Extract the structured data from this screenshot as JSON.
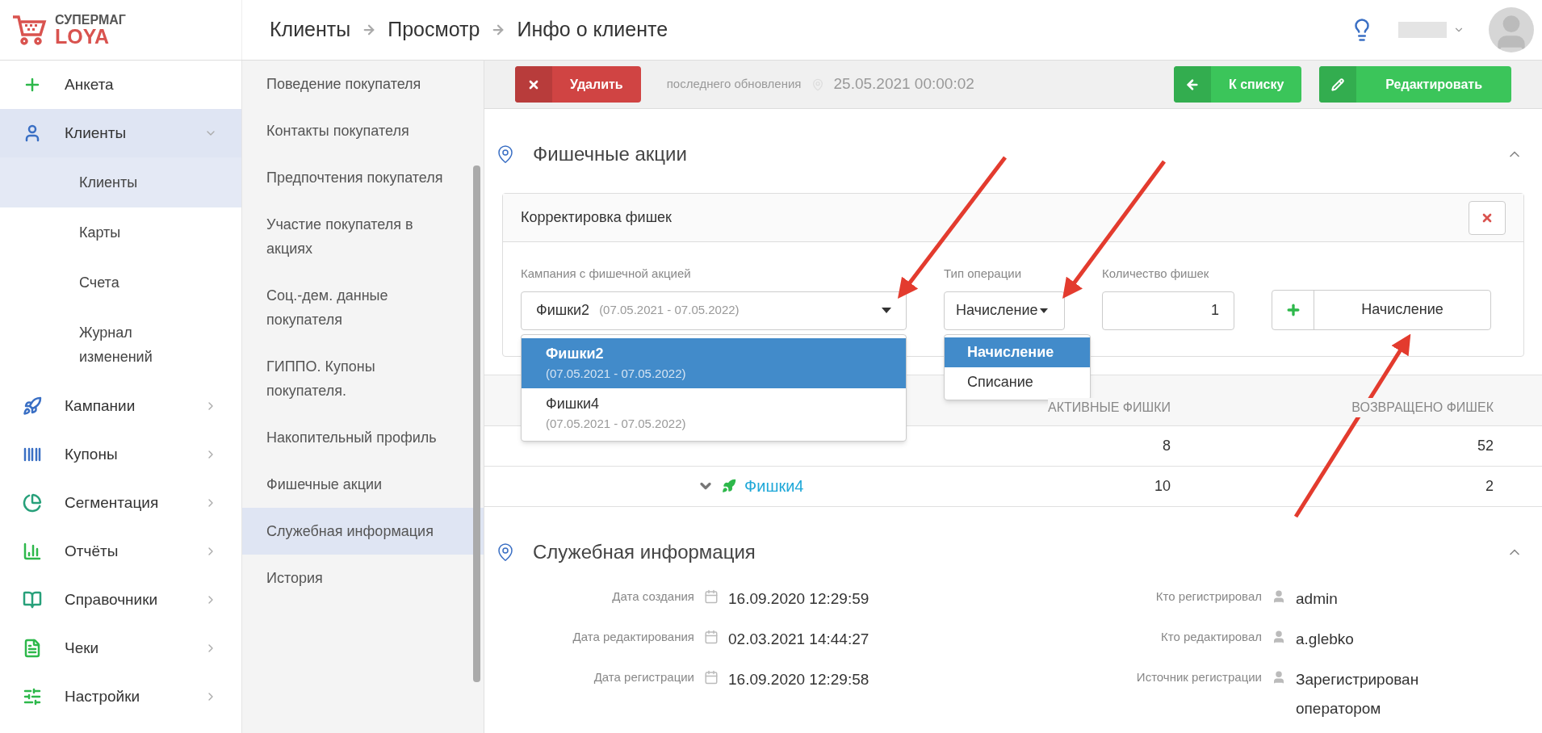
{
  "logo": {
    "top": "СУПЕРМАГ",
    "bottom": "LOYA"
  },
  "breadcrumbs": [
    "Клиенты",
    "Просмотр",
    "Инфо о клиенте"
  ],
  "sidebar": {
    "items": [
      {
        "label": "Анкета",
        "selected": false,
        "expandable": false
      },
      {
        "label": "Клиенты",
        "selected": true,
        "expandable": true,
        "expanded": true,
        "children": [
          {
            "label": "Клиенты",
            "selected": true
          },
          {
            "label": "Карты",
            "selected": false
          },
          {
            "label": "Счета",
            "selected": false
          },
          {
            "label": "Журнал изменений",
            "selected": false
          }
        ]
      },
      {
        "label": "Кампании",
        "selected": false,
        "expandable": true,
        "expanded": false
      },
      {
        "label": "Купоны",
        "selected": false,
        "expandable": true,
        "expanded": false
      },
      {
        "label": "Сегментация",
        "selected": false,
        "expandable": true,
        "expanded": false
      },
      {
        "label": "Отчёты",
        "selected": false,
        "expandable": true,
        "expanded": false
      },
      {
        "label": "Справочники",
        "selected": false,
        "expandable": true,
        "expanded": false
      },
      {
        "label": "Чеки",
        "selected": false,
        "expandable": true,
        "expanded": false
      },
      {
        "label": "Настройки",
        "selected": false,
        "expandable": true,
        "expanded": false
      }
    ]
  },
  "subnav": {
    "items": [
      {
        "label": "Поведение покупателя",
        "selected": false
      },
      {
        "label": "Контакты покупателя",
        "selected": false
      },
      {
        "label": "Предпочтения покупателя",
        "selected": false
      },
      {
        "label": "Участие покупателя в акциях",
        "selected": false
      },
      {
        "label": "Соц.-дем. данные покупателя",
        "selected": false
      },
      {
        "label": "ГИППО. Купоны покупателя.",
        "selected": false
      },
      {
        "label": "Накопительный профиль",
        "selected": false
      },
      {
        "label": "Фишечные акции",
        "selected": false
      },
      {
        "label": "Служебная информация",
        "selected": true
      },
      {
        "label": "История",
        "selected": false
      }
    ]
  },
  "toolbar": {
    "delete_button": "Удалить",
    "update_label": "последнего обновления",
    "update_value": "25.05.2021 00:00:02",
    "back_button": "К списку",
    "edit_button": "Редактировать"
  },
  "chips_section": {
    "title": "Фишечные акции",
    "expanded": true,
    "card": {
      "title": "Корректировка фишек",
      "campaign_label": "Кампания с фишечной акцией",
      "campaign_value": "Фишки2",
      "campaign_period": "(07.05.2021 - 07.05.2022)",
      "operation_label": "Тип операции",
      "operation_value": "Начисление",
      "count_label": "Количество фишек",
      "count_value": "1",
      "submit_button": "Начисление"
    },
    "campaign_options": [
      {
        "name": "Фишки2",
        "period": "(07.05.2021 - 07.05.2022)",
        "selected": true
      },
      {
        "name": "Фишки4",
        "period": "(07.05.2021 - 07.05.2022)",
        "selected": false
      }
    ],
    "operation_options": [
      {
        "label": "Начисление",
        "selected": true
      },
      {
        "label": "Списание",
        "selected": false
      }
    ],
    "table": {
      "columns": [
        "АКТИВНЫЕ ФИШКИ",
        "ВОЗВРАЩЕНО ФИШЕК"
      ],
      "rows": [
        {
          "active": "8",
          "returned": "52"
        },
        {
          "name": "Фишки4",
          "active": "10",
          "returned": "2"
        }
      ]
    }
  },
  "service_section": {
    "title": "Служебная информация",
    "expanded": true,
    "left": [
      {
        "label": "Дата создания",
        "value": "16.09.2020 12:29:59"
      },
      {
        "label": "Дата редактирования",
        "value": "02.03.2021 14:44:27"
      },
      {
        "label": "Дата регистрации",
        "value": "16.09.2020 12:29:58"
      }
    ],
    "right": [
      {
        "label": "Кто регистрировал",
        "value": "admin"
      },
      {
        "label": "Кто редактировал",
        "value": "a.glebko"
      },
      {
        "label": "Источник регистрации",
        "value": "Зарегистрирован оператором"
      }
    ]
  }
}
